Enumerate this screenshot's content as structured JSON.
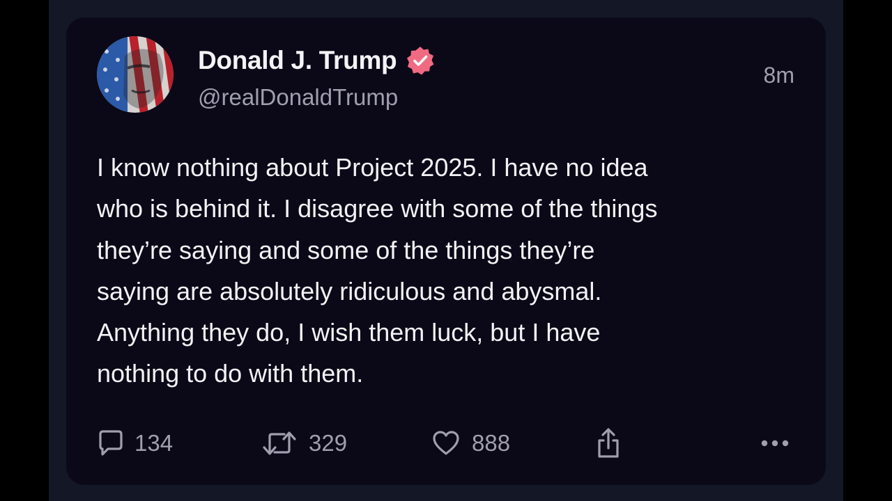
{
  "post": {
    "author_name": "Donald J. Trump",
    "handle": "@realDonaldTrump",
    "timestamp": "8m",
    "body": "I know nothing about Project 2025. I have no idea\nwho is behind it. I disagree with some of the things\nthey’re saying and some of the things they’re\nsaying are absolutely ridiculous and abysmal.\nAnything they do, I wish them luck, but I have\nnothing to do with them."
  },
  "actions": {
    "replies": "134",
    "reposts": "329",
    "likes": "888"
  },
  "icons": {
    "reply": "speech-bubble-icon",
    "repost": "repost-arrows-icon",
    "like": "heart-icon",
    "share": "share-icon",
    "more": "more-horizontal-icon",
    "verified": "verified-badge-icon"
  },
  "colors": {
    "card_background": "#0b0918",
    "page_background": "#141826",
    "text_primary": "#f3f3f5",
    "text_secondary": "#a09fae",
    "verified_badge": "#f06b82"
  }
}
